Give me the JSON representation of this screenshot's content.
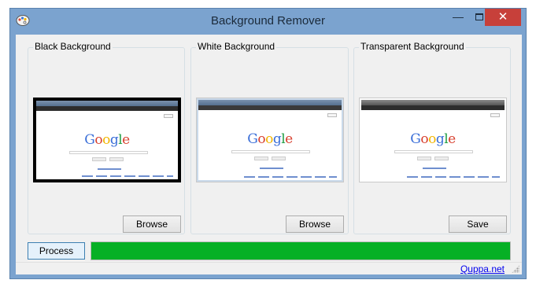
{
  "window": {
    "title": "Background Remover",
    "controls": {
      "minimize": "—",
      "maximize": "",
      "close": "✕"
    },
    "accent_color": "#7ba3cf",
    "close_color": "#c7403a"
  },
  "groups": [
    {
      "label": "Black Background",
      "button": "Browse",
      "preview_bg": "#000000"
    },
    {
      "label": "White Background",
      "button": "Browse",
      "preview_bg": "#ffffff"
    },
    {
      "label": "Transparent Background",
      "button": "Save",
      "preview_bg": "transparent"
    }
  ],
  "preview": {
    "logo": [
      "G",
      "o",
      "o",
      "g",
      "l",
      "e"
    ]
  },
  "process": {
    "button": "Process",
    "progress": 1.0,
    "progress_color": "#06b025"
  },
  "footer": {
    "link": "Quppa.net"
  }
}
